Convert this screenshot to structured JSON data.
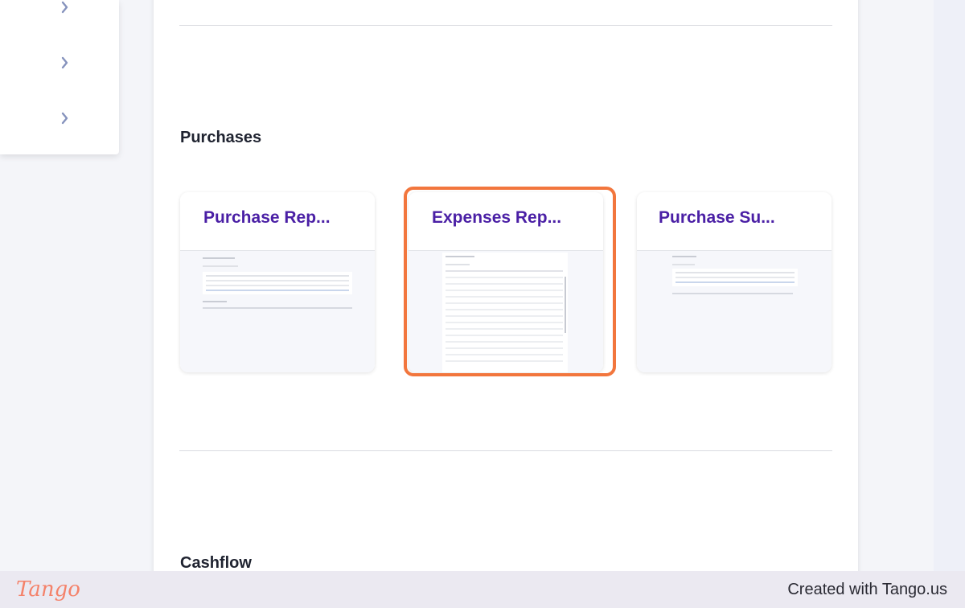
{
  "colors": {
    "title_purple": "#4a1fa5",
    "highlight_orange": "#f2763d",
    "chevron": "#8693bd"
  },
  "sidebar": {
    "items": [
      {
        "icon": "chevron-right-icon"
      },
      {
        "icon": "chevron-right-icon"
      },
      {
        "icon": "chevron-right-icon"
      }
    ]
  },
  "sections": {
    "purchases": {
      "title": "Purchases",
      "cards": [
        {
          "title": "Purchase Rep...",
          "preview_title": "Purchase Report"
        },
        {
          "title": "Expenses Rep...",
          "preview_title": "Expenses Report",
          "highlighted": true
        },
        {
          "title": "Purchase Su...",
          "preview_title": "Purchase Summary"
        }
      ]
    },
    "cashflow": {
      "title": "Cashflow"
    }
  },
  "footer": {
    "logo": "Tango",
    "credit": "Created with Tango.us"
  }
}
